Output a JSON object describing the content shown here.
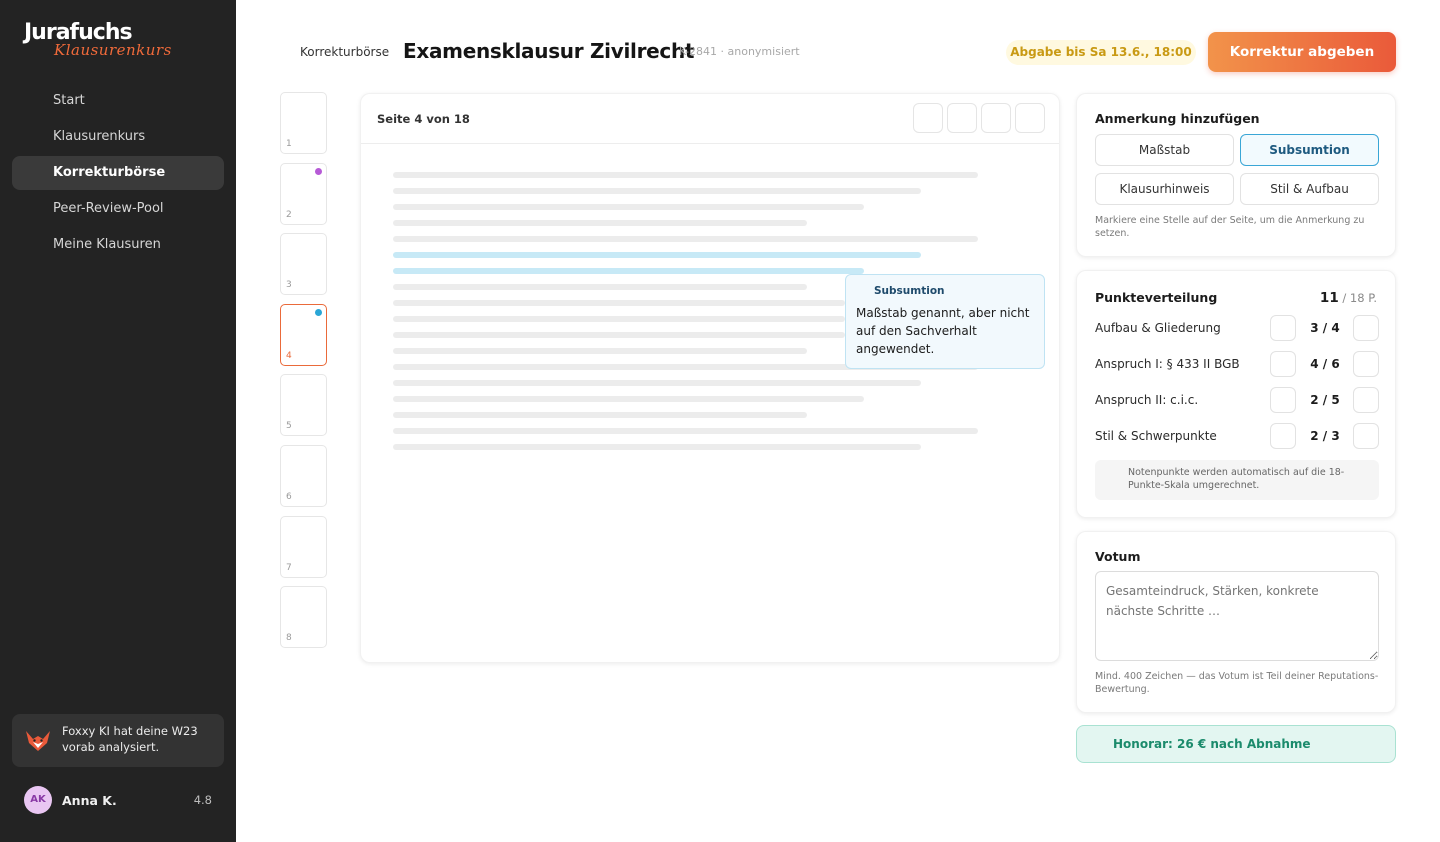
{
  "brand": {
    "name": "Jurafuchs",
    "sub": "Klausurenkurs"
  },
  "nav": [
    {
      "label": "Start",
      "active": false
    },
    {
      "label": "Klausurenkurs",
      "active": false
    },
    {
      "label": "Korrekturbörse",
      "active": true
    },
    {
      "label": "Peer-Review-Pool",
      "active": false
    },
    {
      "label": "Meine Klausuren",
      "active": false
    }
  ],
  "foxxy": {
    "text": "Foxxy KI hat deine W23 vorab analysiert.",
    "icon": "fox-icon"
  },
  "user": {
    "initials": "AK",
    "name": "Anna K.",
    "rating": "4.8"
  },
  "header": {
    "breadcrumb": "Korrekturbörse",
    "title": "Examensklausur Zivilrecht",
    "meta": "K-2841 · anonymisiert",
    "deadline": "Abgabe bis Sa 13.6., 18:00",
    "submit_label": "Korrektur abgeben"
  },
  "thumbnails": [
    {
      "num": "1",
      "dot": null
    },
    {
      "num": "2",
      "dot": "#b65ad6"
    },
    {
      "num": "3",
      "dot": null
    },
    {
      "num": "4",
      "dot": "#2aa6d6",
      "active": true
    },
    {
      "num": "5",
      "dot": null
    },
    {
      "num": "6",
      "dot": null
    },
    {
      "num": "7",
      "dot": null
    },
    {
      "num": "8",
      "dot": null
    }
  ],
  "viewer": {
    "page_label": "Seite 4 von 18",
    "tools": [
      "zoom-out-icon",
      "zoom-in-icon",
      "highlight-icon",
      "comment-icon"
    ],
    "annotation": {
      "tag": "Subsumtion",
      "text": "Maßstab genannt, aber nicht auf den Sachverhalt angewendet."
    }
  },
  "annotate": {
    "title": "Anmerkung hinzufügen",
    "options": [
      "Maßstab",
      "Subsumtion",
      "Klausurhinweis",
      "Stil & Aufbau"
    ],
    "selected": "Subsumtion",
    "hint": "Markiere eine Stelle auf der Seite, um die Anmerkung zu setzen."
  },
  "scoring": {
    "title": "Punkteverteilung",
    "total": "11",
    "max": "/ 18 P.",
    "criteria": [
      {
        "label": "Aufbau & Gliederung",
        "score": "3 / 4"
      },
      {
        "label": "Anspruch I: § 433 II BGB",
        "score": "4 / 6"
      },
      {
        "label": "Anspruch II: c.i.c.",
        "score": "2 / 5"
      },
      {
        "label": "Stil & Schwerpunkte",
        "score": "2 / 3"
      }
    ],
    "info": "Notenpunkte werden automatisch auf die 18-Punkte-Skala umgerechnet."
  },
  "votum": {
    "title": "Votum",
    "placeholder": "Gesamteindruck, Stärken, konkrete nächste Schritte …",
    "hint": "Mind. 400 Zeichen — das Votum ist Teil deiner Reputations-Bewertung."
  },
  "honorar": "Honorar: 26 € nach Abnahme",
  "colors": {
    "accent": "#ea5a3a",
    "sidebar": "#232323",
    "annotation_blue": "#2aa6d6",
    "success": "#1b8b6c"
  }
}
